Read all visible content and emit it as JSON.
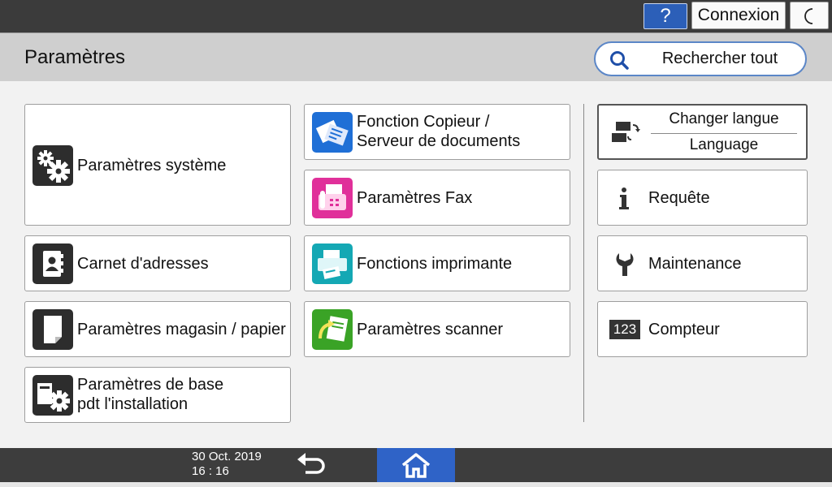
{
  "topbar": {
    "help_label": "?",
    "login_label": "Connexion",
    "moon_icon": "moon-icon"
  },
  "header": {
    "title": "Paramètres",
    "search_label": "Rechercher tout"
  },
  "left_tiles": [
    {
      "label": "Paramètres système",
      "icon": "gears-icon"
    },
    {
      "label": "Carnet d'adresses",
      "icon": "address-book-icon"
    },
    {
      "label": "Paramètres magasin / papier",
      "icon": "paper-icon"
    },
    {
      "label": "Paramètres de base\npdt l'installation",
      "icon": "setup-gear-icon"
    }
  ],
  "middle_tiles": [
    {
      "label": "Fonction Copieur /\nServeur de documents",
      "icon": "copier-icon",
      "color": "#1f6fd6"
    },
    {
      "label": "Paramètres Fax",
      "icon": "fax-icon",
      "color": "#e0309a"
    },
    {
      "label": "Fonctions imprimante",
      "icon": "printer-icon",
      "color": "#14a8b4"
    },
    {
      "label": "Paramètres scanner",
      "icon": "scanner-icon",
      "color": "#3aa326"
    }
  ],
  "right_tiles": {
    "language": {
      "top": "Changer langue",
      "bottom": "Language"
    },
    "items": [
      {
        "label": "Requête",
        "icon": "info-icon"
      },
      {
        "label": "Maintenance",
        "icon": "wrench-icon"
      },
      {
        "label": "Compteur",
        "icon": "counter-icon"
      }
    ],
    "counter_glyph": "123"
  },
  "bottombar": {
    "date": "30 Oct. 2019",
    "time": "16 : 16"
  },
  "colors": {
    "accent": "#2f63c7",
    "topbar": "#3b3b3b",
    "header": "#cfcfcf"
  }
}
